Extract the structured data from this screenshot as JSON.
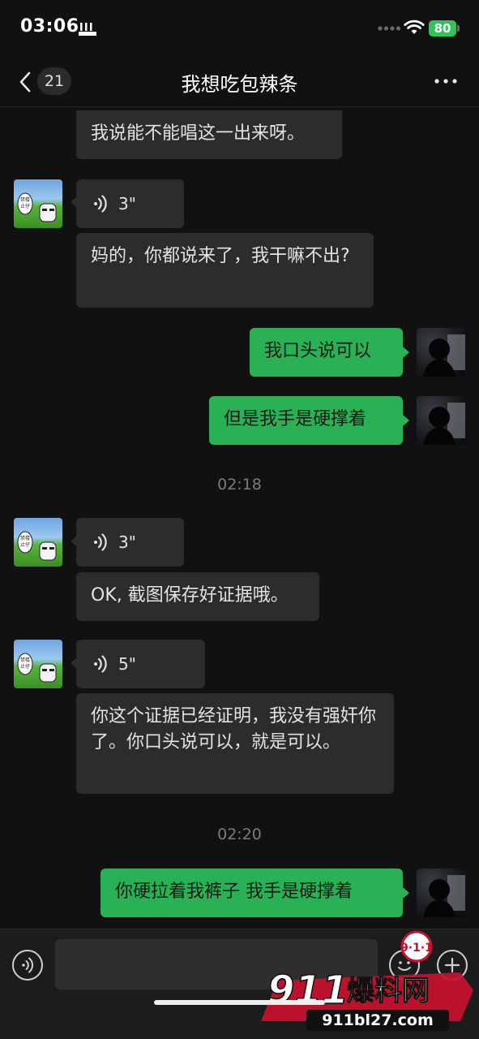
{
  "status_bar": {
    "time": "03:06",
    "battery": "80"
  },
  "nav": {
    "unread_count": "21",
    "title": "我想吃包辣条"
  },
  "messages": {
    "m1": "我说能不能唱这一出来呀。",
    "v1": "3\"",
    "m2": "妈的，你都说来了，我干嘛不出?",
    "m3": "我口头说可以",
    "m4": "但是我手是硬撑着",
    "ts1": "02:18",
    "v2": "3\"",
    "m5": "OK, 截图保存好证据哦。",
    "v3": "5\"",
    "m6": "你这个证据已经证明，我没有强奸你了。你口头说可以，就是可以。",
    "ts2": "02:20",
    "m7": "你硬拉着我裤子 我手是硬撑着"
  },
  "avatar_badge": "禁止楼仔",
  "watermark": {
    "logo_badge": "9·1·1",
    "logo_text_num": "911",
    "logo_text_cn": "爆料网",
    "url": "911bl27.com"
  },
  "colors": {
    "background": "#111111",
    "incoming_bubble": "#2c2c2c",
    "outgoing_bubble": "#2ab156",
    "battery": "#35c25a",
    "timestamp": "#7b7b7b"
  },
  "icons": [
    "back-chevron-icon",
    "more-dots-icon",
    "voice-wave-icon",
    "voice-input-icon",
    "emoji-icon",
    "plus-icon",
    "wifi-icon",
    "signal-dots-icon"
  ]
}
